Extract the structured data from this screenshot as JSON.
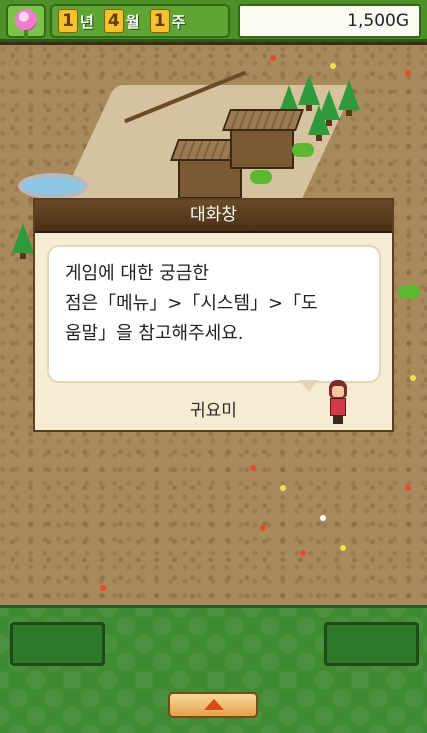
{
  "hud": {
    "year": "1",
    "year_unit": "년",
    "month": "4",
    "month_unit": "월",
    "week": "1",
    "week_unit": "주",
    "gold": "1,500G"
  },
  "dialog": {
    "title": "대화창",
    "message_lines": [
      "게임에 대한 궁금한",
      "점은「메뉴」>「시스템」>「도",
      "움말」을 참고해주세요."
    ],
    "speaker": "귀요미"
  },
  "icons": {
    "hud": "flower-icon",
    "menu": "arrow-up-icon"
  }
}
